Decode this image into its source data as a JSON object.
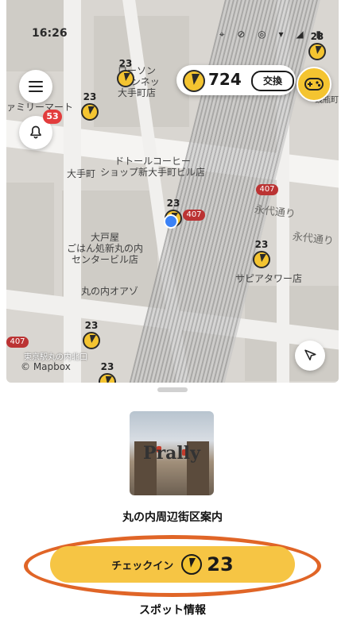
{
  "status_bar": {
    "time": "16:26",
    "icons": [
      "404-icon",
      "person-icon",
      "bluetooth-icon",
      "location-icon",
      "mute-icon",
      "data-saver-icon",
      "wifi-icon",
      "signal-icon",
      "battery-icon"
    ]
  },
  "header": {
    "points": "724",
    "exchange_label": "交換"
  },
  "notifications": {
    "count": "53"
  },
  "map": {
    "labels": {
      "lawson": "ローソン\n-パンネッ\n大手町店",
      "family_mart": "ァミリーマート",
      "doutor": "ドトールコーヒー\nショップ新大手町ビル店",
      "otemachi": "大手町",
      "yosaya": "大戸屋\nごはん処新丸の内\nセンタービル店",
      "marunouchi_oazo": "丸の内オアゾ",
      "eitai": "永代通り",
      "eitai2": "永代通り",
      "sapia": "サピアタワー店",
      "station": "東京駅丸の内北口",
      "tokiwa": "銭瓶町",
      "mapbox": "© Mapbox"
    },
    "pin_value": "23",
    "route_badge": "407"
  },
  "spot": {
    "image_logo": "Prally",
    "title": "丸の内周辺街区案内",
    "checkin_label": "チェックイン",
    "checkin_points": "23",
    "info_label": "スポット情報"
  },
  "colors": {
    "accent_yellow": "#f6c544",
    "annotation_orange": "#e06527",
    "coin": "#f4c430",
    "location_blue": "#3b82f6"
  }
}
